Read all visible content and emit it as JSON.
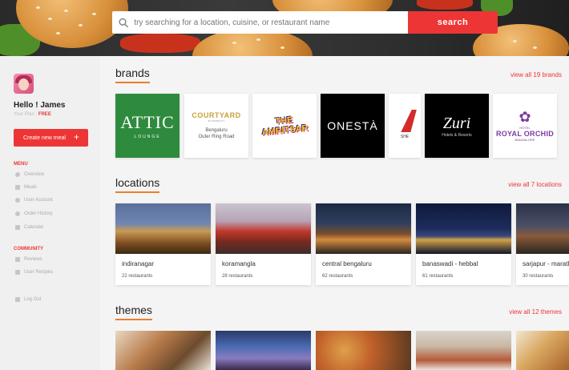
{
  "search": {
    "placeholder": "try searching for a location, cuisine, or restaurant name",
    "button_label": "search"
  },
  "user": {
    "greeting": "Hello ! James",
    "plan_label": "Your Plan : ",
    "plan_value": "FREE"
  },
  "sidebar": {
    "create_label": "Create new meal",
    "create_icon": "+",
    "menu_title": "MENU",
    "menu_items": [
      {
        "label": "Overview",
        "icon": "speedometer-icon"
      },
      {
        "label": "Meals",
        "icon": "meals-icon"
      },
      {
        "label": "User Account",
        "icon": "user-icon"
      },
      {
        "label": "Order History",
        "icon": "history-icon"
      },
      {
        "label": "Calendar",
        "icon": "calendar-icon"
      }
    ],
    "community_title": "COMMUNITY",
    "community_items": [
      {
        "label": "Reviews",
        "icon": "reviews-icon"
      },
      {
        "label": "User Recipes",
        "icon": "recipes-icon"
      }
    ],
    "logout_label": "Log Out",
    "logout_icon": "logout-icon"
  },
  "brands": {
    "title": "brands",
    "view_all": "view all 19 brands",
    "items": [
      {
        "name": "ATTIC",
        "sub": "LOUNGE"
      },
      {
        "name": "COURTYARD",
        "sub": "BY MARRIOTT",
        "address_1": "Bengaluru",
        "address_2": "Outer Ring Road"
      },
      {
        "name": "THE AMRITSAR"
      },
      {
        "name": "ONESTÀ"
      },
      {
        "name": "SHE"
      },
      {
        "name": "Zuri",
        "sub": "Hotels & Resorts"
      },
      {
        "name": "ROYAL ORCHID",
        "sub": "HOTEL",
        "city": "BANGALORE"
      }
    ]
  },
  "locations": {
    "title": "locations",
    "view_all": "view all 7 locations",
    "items": [
      {
        "name": "indiranagar",
        "count": "22 restaurants"
      },
      {
        "name": "koramangla",
        "count": "28 restaurants"
      },
      {
        "name": "central bengaluru",
        "count": "62 restaurants"
      },
      {
        "name": "banaswadi - hebbal",
        "count": "61 restaurants"
      },
      {
        "name": "sarjapur - marathahalli",
        "count": "30 restaurants"
      }
    ]
  },
  "themes": {
    "title": "themes",
    "view_all": "view all 12 themes"
  },
  "colors": {
    "accent": "#ee3535",
    "underline": "#ee7d2b",
    "sidebar_bg": "#f0f0f0"
  }
}
